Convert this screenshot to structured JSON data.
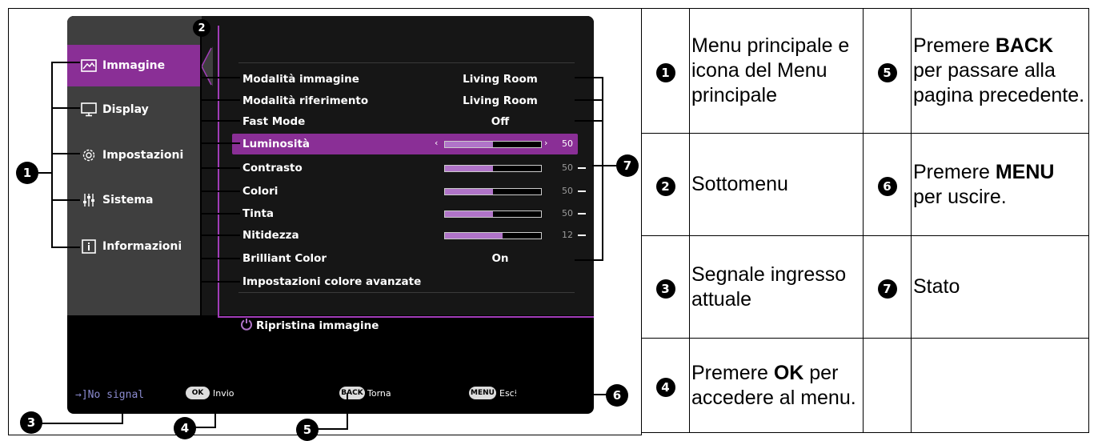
{
  "osd": {
    "sidebar": [
      {
        "label": "Immagine",
        "icon": "picture-icon",
        "selected": true
      },
      {
        "label": "Display",
        "icon": "display-icon",
        "selected": false
      },
      {
        "label": "Impostazioni",
        "icon": "gear-icon",
        "selected": false
      },
      {
        "label": "Sistema",
        "icon": "sliders-icon",
        "selected": false
      },
      {
        "label": "Informazioni",
        "icon": "info-icon",
        "selected": false
      }
    ],
    "rows": [
      {
        "label": "Modalità immagine",
        "value": "Living Room"
      },
      {
        "label": "Modalità riferimento",
        "value": "Living Room"
      },
      {
        "label": "Fast Mode",
        "value": "Off"
      },
      {
        "label": "Luminosità",
        "value": "50",
        "level": 0.5,
        "selected": true
      },
      {
        "label": "Contrasto",
        "value": "50",
        "level": 0.5
      },
      {
        "label": "Colori",
        "value": "50",
        "level": 0.5
      },
      {
        "label": "Tinta",
        "value": "50",
        "level": 0.5
      },
      {
        "label": "Nitidezza",
        "value": "12",
        "level": 0.6
      },
      {
        "label": "Brilliant Color",
        "value": "On"
      },
      {
        "label": "Impostazioni colore avanzate",
        "value": ""
      }
    ],
    "reset_label": "Ripristina immagine",
    "signal": "No signal",
    "hints": [
      {
        "key": "OK",
        "text": "Invio"
      },
      {
        "key": "BACK",
        "text": "Torna"
      },
      {
        "key": "MENU",
        "text": "Esci"
      }
    ]
  },
  "callouts": [
    "1",
    "2",
    "3",
    "4",
    "5",
    "6",
    "7"
  ],
  "legend": {
    "rows": [
      {
        "n1": "1",
        "t1": "Menu principale e icona del Menu principale",
        "n2": "5",
        "t2_pre": "Premere ",
        "t2_bold": "BACK",
        "t2_post": " per passare alla pagina precedente."
      },
      {
        "n1": "2",
        "t1": "Sottomenu",
        "n2": "6",
        "t2_pre": "Premere ",
        "t2_bold": "MENU",
        "t2_post": " per uscire."
      },
      {
        "n1": "3",
        "t1": "Segnale ingresso attuale",
        "n2": "7",
        "t2_pre": "Stato",
        "t2_bold": "",
        "t2_post": ""
      },
      {
        "n1": "4",
        "t1_pre": "Premere ",
        "t1_bold": "OK",
        "t1_post": " per accedere al menu.",
        "n2": "",
        "t2_pre": "",
        "t2_bold": "",
        "t2_post": ""
      }
    ]
  },
  "colors": {
    "accent": "#8a2f96",
    "bar_fill": "#b074c8",
    "sidebar": "#3f3f3f",
    "signal_text": "#8b8bd0"
  }
}
